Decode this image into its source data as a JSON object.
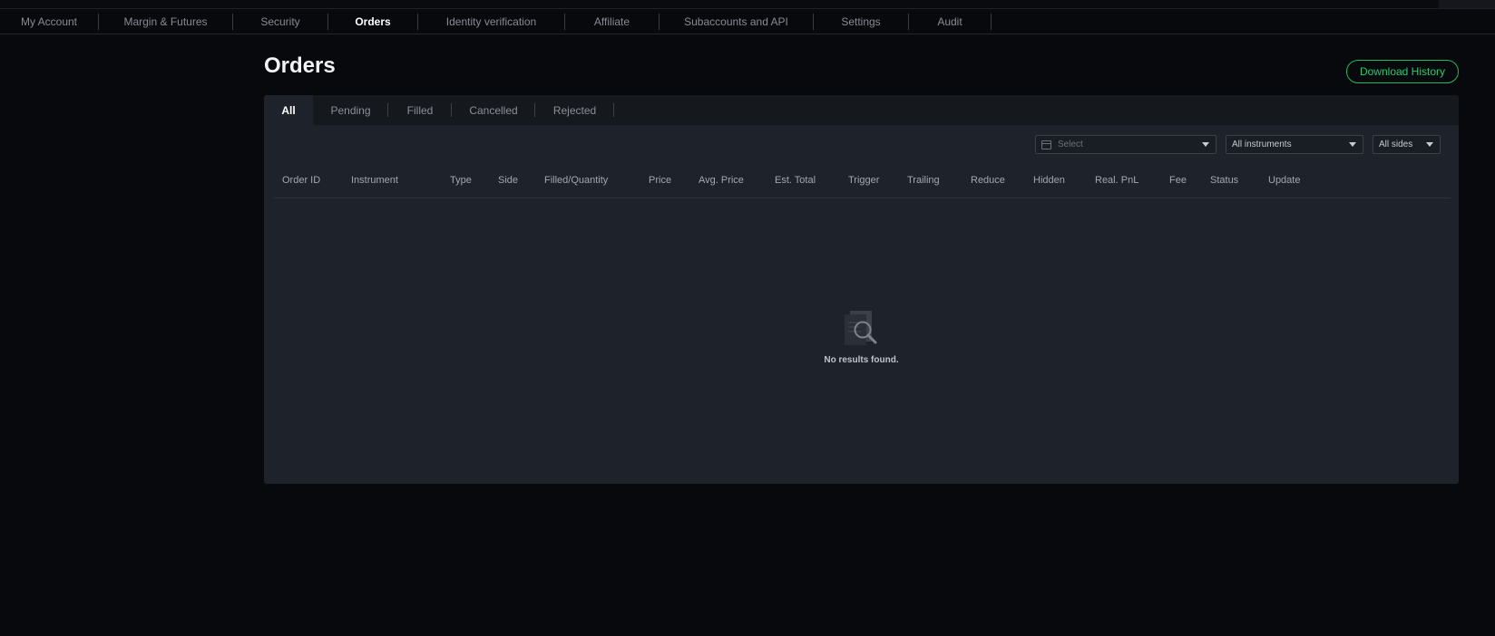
{
  "nav": {
    "items": [
      {
        "label": "My Account",
        "active": false
      },
      {
        "label": "Margin & Futures",
        "active": false
      },
      {
        "label": "Security",
        "active": false
      },
      {
        "label": "Orders",
        "active": true
      },
      {
        "label": "Identity verification",
        "active": false
      },
      {
        "label": "Affiliate",
        "active": false
      },
      {
        "label": "Subaccounts and API",
        "active": false
      },
      {
        "label": "Settings",
        "active": false
      },
      {
        "label": "Audit",
        "active": false
      }
    ]
  },
  "page": {
    "title": "Orders",
    "download_label": "Download History"
  },
  "tabs": [
    {
      "label": "All",
      "active": true
    },
    {
      "label": "Pending",
      "active": false
    },
    {
      "label": "Filled",
      "active": false
    },
    {
      "label": "Cancelled",
      "active": false
    },
    {
      "label": "Rejected",
      "active": false
    }
  ],
  "filters": {
    "date_placeholder": "Select",
    "instrument_value": "All instruments",
    "side_value": "All sides"
  },
  "table": {
    "columns": [
      "Order ID",
      "Instrument",
      "Type",
      "Side",
      "Filled/Quantity",
      "Price",
      "Avg. Price",
      "Est. Total",
      "Trigger",
      "Trailing",
      "Reduce",
      "Hidden",
      "Real. PnL",
      "Fee",
      "Status",
      "Update"
    ]
  },
  "empty_state": {
    "icon": "document-search-icon",
    "text": "No results found."
  },
  "colors": {
    "background": "#08090c",
    "panel": "#1e222a",
    "accent_green": "#27cc70"
  }
}
